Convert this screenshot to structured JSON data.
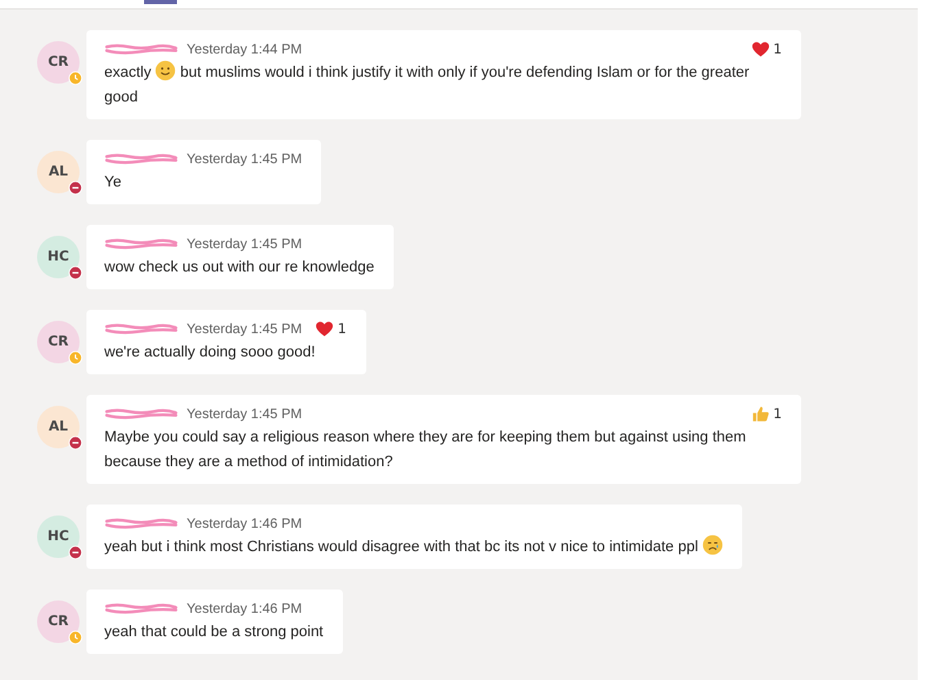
{
  "messages": [
    {
      "initials": "CR",
      "color": "#f3d6e4",
      "status": {
        "kind": "away"
      },
      "name_redacted": true,
      "time": "Yesterday 1:44 PM",
      "segments": [
        {
          "kind": "text",
          "text": "exactly"
        },
        {
          "kind": "smile"
        },
        {
          "kind": "text",
          "text": "but muslims would i think justify it with only if you're defending Islam or for the greater good"
        }
      ],
      "reaction": {
        "kind": "heart",
        "count": "1"
      }
    },
    {
      "initials": "AL",
      "color": "#fbe6d2",
      "status": {
        "kind": "busy"
      },
      "name_redacted": true,
      "time": "Yesterday 1:45 PM",
      "segments": [
        {
          "kind": "text",
          "text": "Ye"
        }
      ]
    },
    {
      "initials": "HC",
      "color": "#d4ece1",
      "status": {
        "kind": "busy"
      },
      "name_redacted": true,
      "time": "Yesterday 1:45 PM",
      "segments": [
        {
          "kind": "text",
          "text": "wow check us out with our re knowledge"
        }
      ]
    },
    {
      "initials": "CR",
      "color": "#f3d6e4",
      "status": {
        "kind": "away"
      },
      "name_redacted": true,
      "time": "Yesterday 1:45 PM",
      "segments": [
        {
          "kind": "text",
          "text": "we're actually doing sooo good!"
        }
      ],
      "reaction": {
        "kind": "heart",
        "count": "1"
      }
    },
    {
      "initials": "AL",
      "color": "#fbe6d2",
      "status": {
        "kind": "busy"
      },
      "name_redacted": true,
      "time": "Yesterday 1:45 PM",
      "segments": [
        {
          "kind": "text",
          "text": "Maybe you could say a religious reason where they are for keeping them but against using them because they are a method of intimidation?"
        }
      ],
      "reaction": {
        "kind": "like",
        "count": "1"
      }
    },
    {
      "initials": "HC",
      "color": "#d4ece1",
      "status": {
        "kind": "busy"
      },
      "name_redacted": true,
      "time": "Yesterday 1:46 PM",
      "segments": [
        {
          "kind": "text",
          "text": "yeah but i think most Christians would disagree with that bc its not v nice to intimidate ppl"
        },
        {
          "kind": "crying"
        }
      ]
    },
    {
      "initials": "CR",
      "color": "#f3d6e4",
      "status": {
        "kind": "away"
      },
      "name_redacted": true,
      "time": "Yesterday 1:46 PM",
      "segments": [
        {
          "kind": "text",
          "text": "yeah that could be a strong point"
        }
      ]
    }
  ]
}
